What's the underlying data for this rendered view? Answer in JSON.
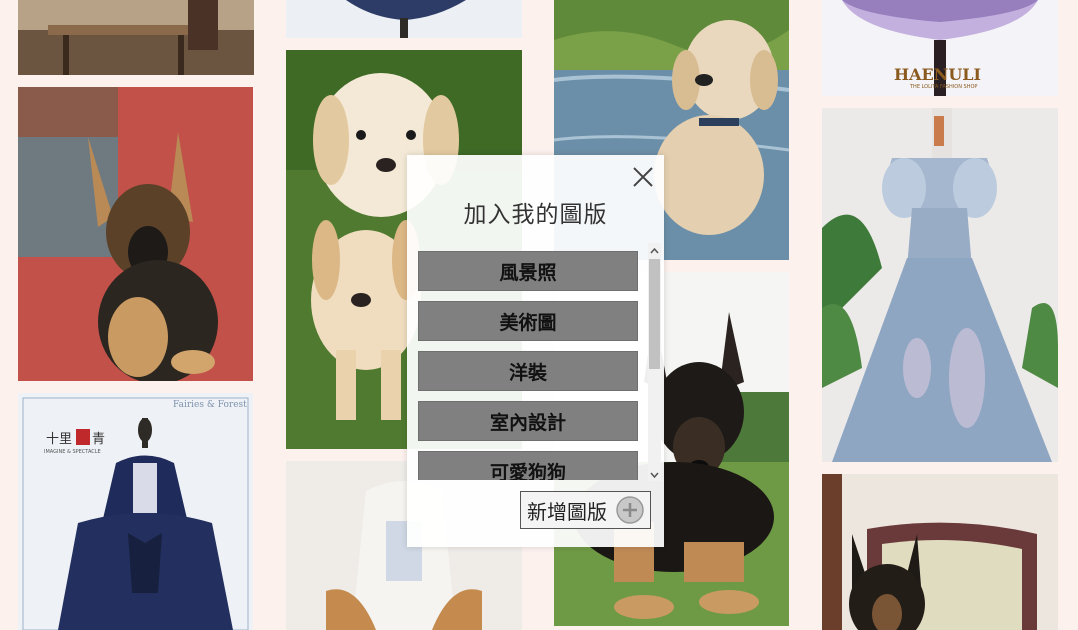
{
  "gallery": {
    "tiles": [
      {
        "name": "photo-dining-table",
        "description_icon": "photo-icon"
      },
      {
        "name": "photo-german-shepherd-puppy",
        "description_icon": "photo-icon"
      },
      {
        "name": "photo-lolita-dress-fairies-forest",
        "description_icon": "photo-icon",
        "brand_text": "Fairies & Forest",
        "logo_text": "十里 Imagine & Spectacle"
      },
      {
        "name": "photo-dress-top",
        "description_icon": "photo-icon"
      },
      {
        "name": "photo-labrador-puppies",
        "description_icon": "photo-icon"
      },
      {
        "name": "photo-doll-dress",
        "description_icon": "photo-icon"
      },
      {
        "name": "photo-golden-puppy-water",
        "description_icon": "photo-icon"
      },
      {
        "name": "photo-german-shepherd-lying",
        "description_icon": "photo-icon"
      },
      {
        "name": "photo-lolita-umbrella-dress",
        "description_icon": "photo-icon",
        "logo_text": "HAENULI"
      },
      {
        "name": "photo-blue-ball-gown",
        "description_icon": "photo-icon"
      },
      {
        "name": "photo-shepherd-armchair",
        "description_icon": "photo-icon"
      }
    ]
  },
  "modal": {
    "title": "加入我的圖版",
    "close_icon": "close-icon",
    "boards": [
      {
        "label": "風景照"
      },
      {
        "label": "美術圖"
      },
      {
        "label": "洋裝"
      },
      {
        "label": "室內設計"
      },
      {
        "label": "可愛狗狗"
      }
    ],
    "add_board_label": "新增圖版",
    "add_icon": "plus-circle-icon"
  },
  "colors": {
    "page_background": "#fdf1ee",
    "board_button": "#808080"
  }
}
